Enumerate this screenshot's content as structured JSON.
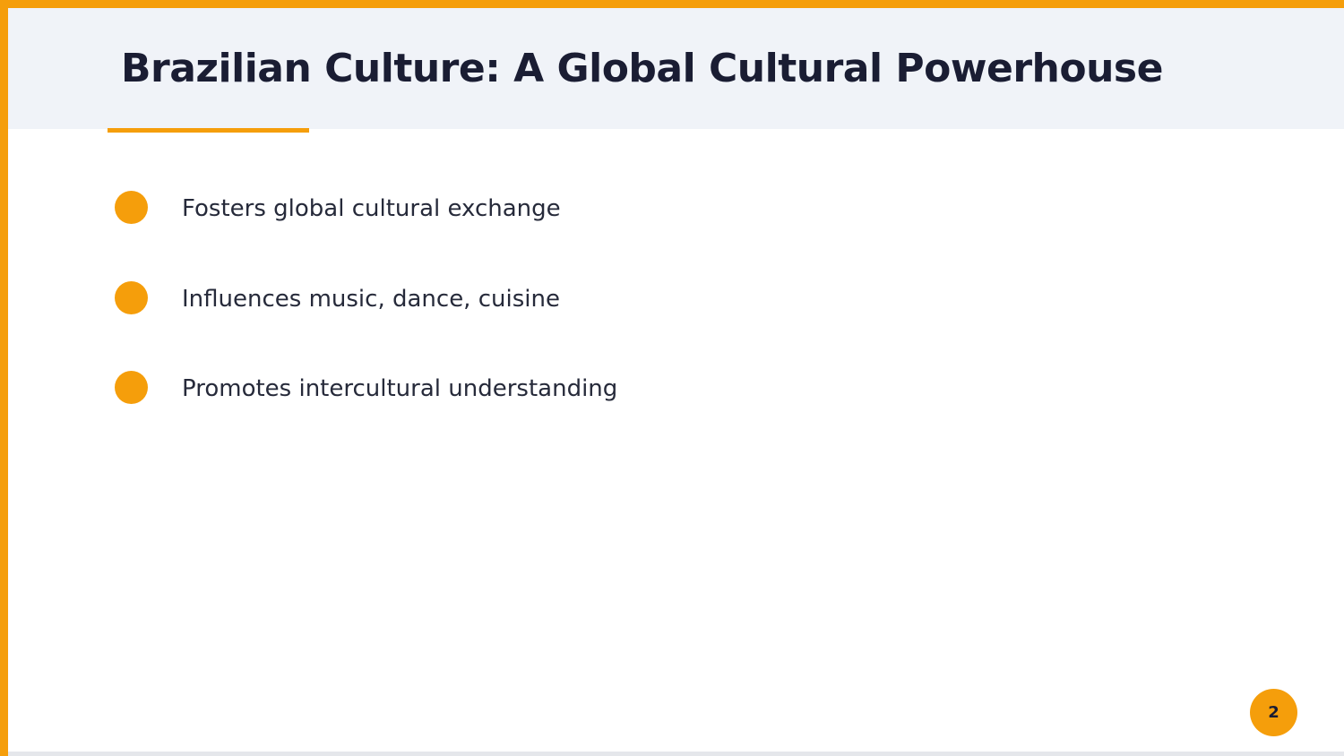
{
  "slide": {
    "title": "Brazilian Culture: A Global Cultural Powerhouse",
    "bullets": [
      "Fosters global cultural exchange",
      "Influences music, dance, cuisine",
      "Promotes intercultural understanding"
    ],
    "page_number": "2"
  },
  "colors": {
    "accent": "#f59e0b",
    "header_bg": "#f0f3f8",
    "title_text": "#1a1d33",
    "body_text": "#262a3a"
  }
}
